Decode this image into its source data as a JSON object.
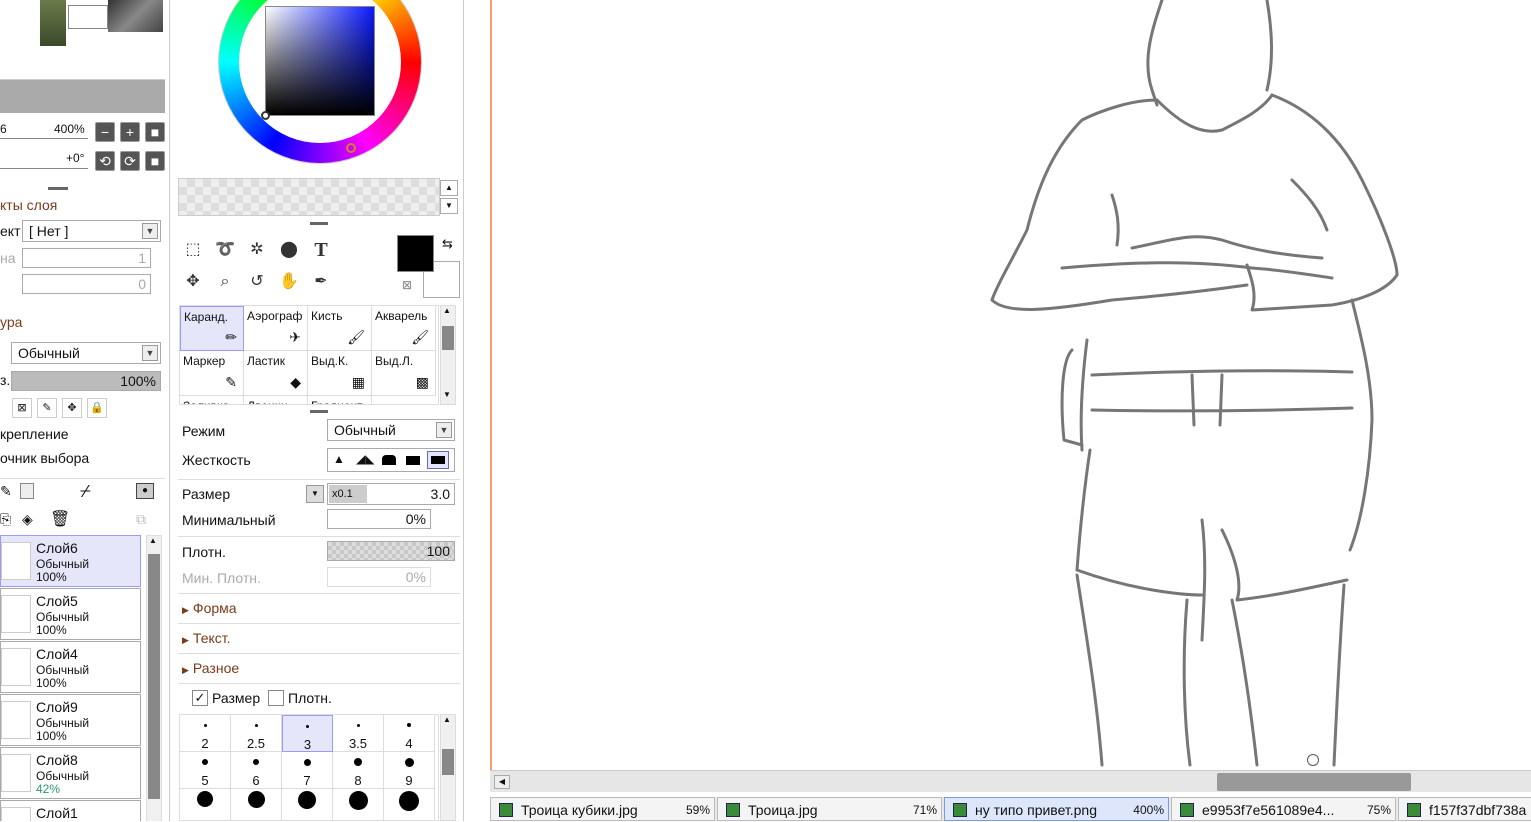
{
  "navigator": {
    "zoom": "400%",
    "zoom_left": "6",
    "rotation": "+0°"
  },
  "layer_effects": {
    "title": "кты слоя",
    "texture_label": "ект",
    "texture_value": "[ Нет ]",
    "width_label": "на",
    "width_value": "1",
    "strength_value": "0"
  },
  "blend": {
    "title": "ура",
    "mode_value": "Обычный",
    "opacity_label": "з.",
    "opacity_value": "100%"
  },
  "options": {
    "clip_label": "крепление",
    "source_label": "очник выбора"
  },
  "layers": [
    {
      "name": "Слой6",
      "mode": "Обычный",
      "opacity": "100%",
      "selected": true
    },
    {
      "name": "Слой5",
      "mode": "Обычный",
      "opacity": "100%",
      "selected": false
    },
    {
      "name": "Слой4",
      "mode": "Обычный",
      "opacity": "100%",
      "selected": false
    },
    {
      "name": "Слой9",
      "mode": "Обычный",
      "opacity": "100%",
      "selected": false
    },
    {
      "name": "Слой8",
      "mode": "Обычный",
      "opacity": "42%",
      "selected": false
    },
    {
      "name": "Слой1",
      "mode": "",
      "opacity": "",
      "selected": false
    }
  ],
  "tools": {
    "text_tool_glyph": "T"
  },
  "brushes": [
    {
      "label": "Каранд.",
      "icon": "pencil-icon"
    },
    {
      "label": "Аэрограф",
      "icon": "airbrush-icon"
    },
    {
      "label": "Кисть",
      "icon": "brush-icon"
    },
    {
      "label": "Акварель",
      "icon": "watercolor-icon"
    },
    {
      "label": "Маркер",
      "icon": "marker-icon"
    },
    {
      "label": "Ластик",
      "icon": "eraser-icon"
    },
    {
      "label": "Выд.К.",
      "icon": "select-pen-icon"
    },
    {
      "label": "Выд.Л.",
      "icon": "select-eraser-icon"
    },
    {
      "label": "Заливка",
      "icon": ""
    },
    {
      "label": "Двоичн",
      "icon": ""
    },
    {
      "label": "Градиент",
      "icon": ""
    }
  ],
  "brush_props": {
    "mode_label": "Режим",
    "mode_value": "Обычный",
    "hardness_label": "Жесткость",
    "size_label": "Размер",
    "size_mult": "x0.1",
    "size_value": "3.0",
    "min_label": "Минимальный",
    "min_value": "0%",
    "density_label": "Плотн.",
    "density_value": "100",
    "min_density_label": "Мин. Плотн.",
    "min_density_value": "0%",
    "section_shape": "Форма",
    "section_texture": "Текст.",
    "section_misc": "Разное",
    "check_size_label": "Размер",
    "check_density_label": "Плотн."
  },
  "brush_sizes": [
    "2",
    "2.5",
    "3",
    "3.5",
    "4",
    "5",
    "6",
    "7",
    "8",
    "9"
  ],
  "tabs": [
    {
      "name": "Троица кубики.jpg",
      "zoom": "59%",
      "selected": false
    },
    {
      "name": "Троица.jpg",
      "zoom": "71%",
      "selected": false
    },
    {
      "name": "ну типо привет.png",
      "zoom": "400%",
      "selected": true
    },
    {
      "name": "e9953f7e561089e4...",
      "zoom": "75%",
      "selected": false
    },
    {
      "name": "f157f37dbf738a",
      "zoom": "",
      "selected": false
    }
  ],
  "colors": {
    "accent_text": "#7a3b1a",
    "selection": "#e6e6fa",
    "primary_color": "#000000",
    "secondary_color": "#ffffff"
  }
}
